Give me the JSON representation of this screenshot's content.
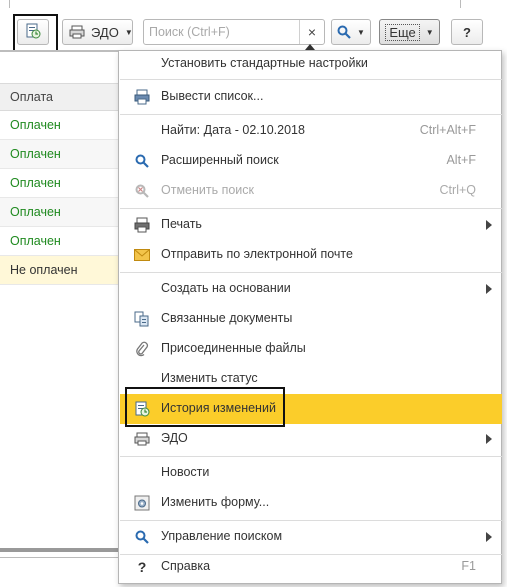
{
  "toolbar": {
    "edo_label": "ЭДО",
    "search_placeholder": "Поиск (Ctrl+F)",
    "search_value": "",
    "clear_glyph": "×",
    "more_label": "Еще",
    "help_label": "?",
    "colors": {
      "highlight_border": "#111111"
    }
  },
  "table": {
    "header": "Оплата",
    "rows": [
      {
        "status": "Оплачен"
      },
      {
        "status": "Оплачен"
      },
      {
        "status": "Оплачен"
      },
      {
        "status": "Оплачен"
      },
      {
        "status": "Оплачен"
      },
      {
        "status": "Не оплачен"
      }
    ],
    "colors": {
      "paid": "#1f8a1f",
      "unpaid_row_bg": "#fff8d8"
    }
  },
  "menu": {
    "accent_color": "#fbcd2a",
    "items": [
      {
        "label": "Установить стандартные настройки",
        "icon": "none"
      },
      {
        "label": "Вывести список...",
        "icon": "printer-list-icon"
      },
      {
        "label": "Найти: Дата - 02.10.2018",
        "shortcut": "Ctrl+Alt+F",
        "icon": "none"
      },
      {
        "label": "Расширенный поиск",
        "shortcut": "Alt+F",
        "icon": "search-icon"
      },
      {
        "label": "Отменить поиск",
        "shortcut": "Ctrl+Q",
        "icon": "cancel-search-icon",
        "disabled": true
      },
      {
        "label": "Печать",
        "icon": "printer-icon",
        "submenu": true
      },
      {
        "label": "Отправить по электронной почте",
        "icon": "envelope-icon"
      },
      {
        "label": "Создать на основании",
        "icon": "none",
        "submenu": true
      },
      {
        "label": "Связанные документы",
        "icon": "linked-documents-icon"
      },
      {
        "label": "Присоединенные файлы",
        "icon": "paperclip-icon"
      },
      {
        "label": "Изменить статус",
        "icon": "none"
      },
      {
        "label": "История изменений",
        "icon": "history-icon",
        "active": true
      },
      {
        "label": "ЭДО",
        "icon": "edo-icon",
        "submenu": true
      },
      {
        "label": "Новости",
        "icon": "none"
      },
      {
        "label": "Изменить форму...",
        "icon": "form-settings-icon"
      },
      {
        "label": "Управление поиском",
        "icon": "search-icon",
        "submenu": true
      },
      {
        "label": "Справка",
        "shortcut": "F1",
        "icon": "help-icon"
      }
    ]
  }
}
